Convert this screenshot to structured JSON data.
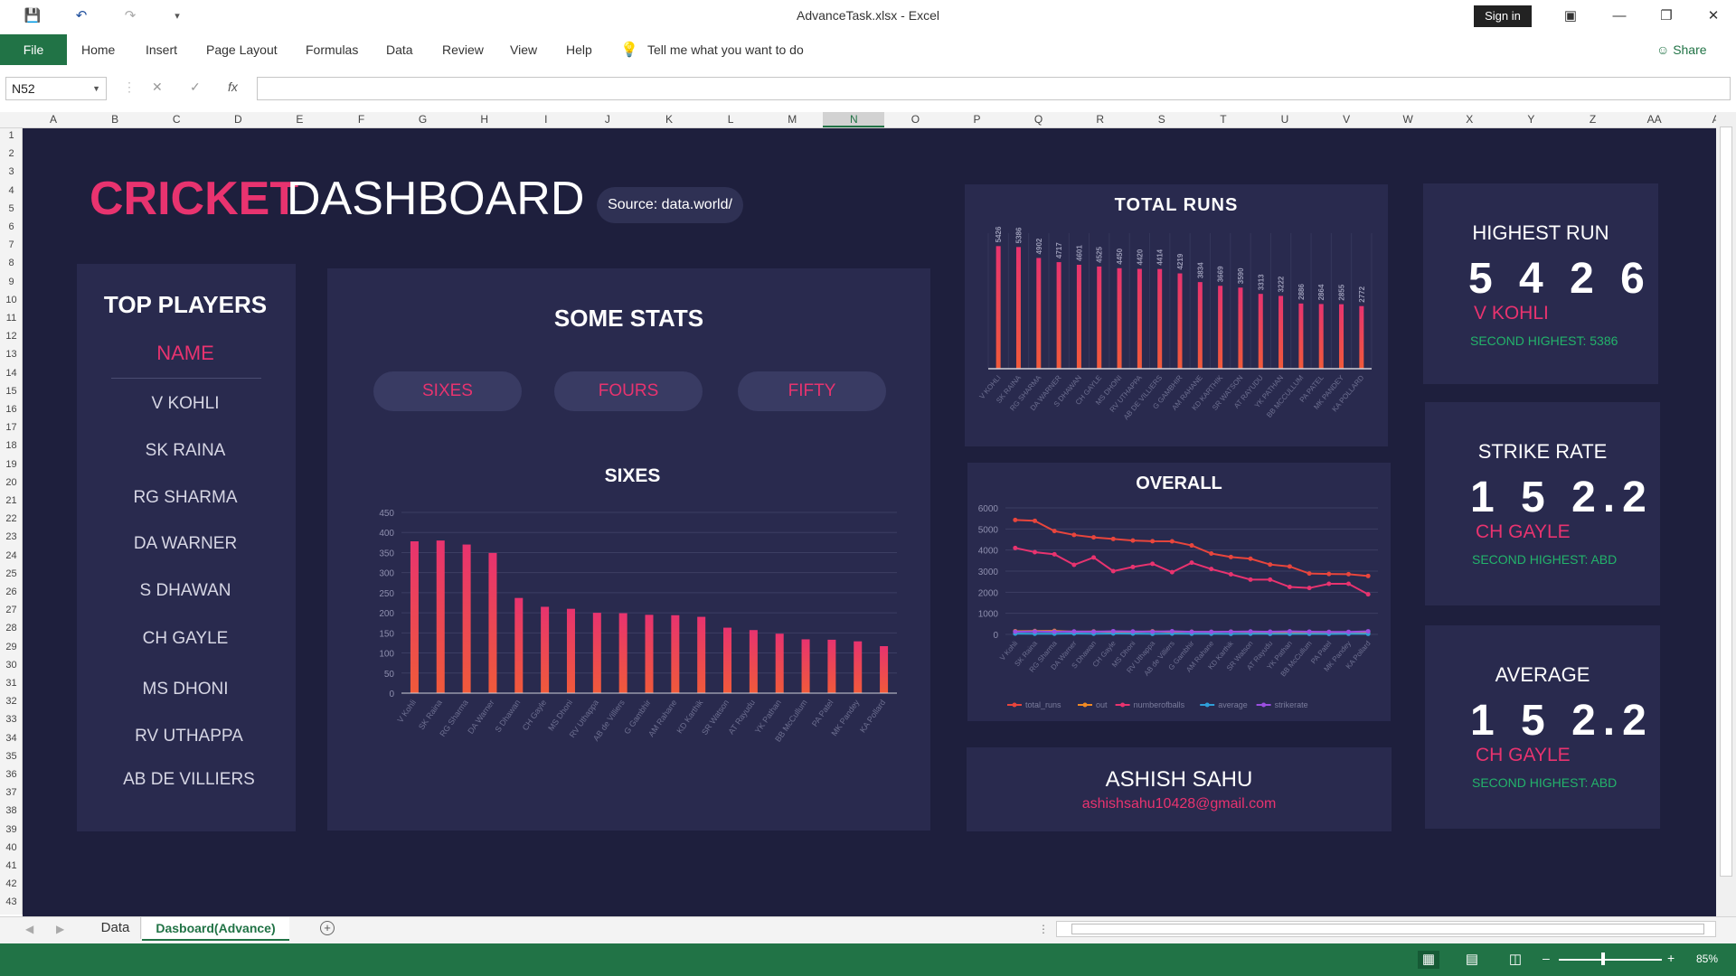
{
  "window": {
    "title": "AdvanceTask.xlsx  -  Excel",
    "sign_in": "Sign in",
    "share": "Share"
  },
  "ribbon": {
    "file": "File",
    "tabs": [
      "Home",
      "Insert",
      "Page Layout",
      "Formulas",
      "Data",
      "Review",
      "View",
      "Help"
    ],
    "tell_me": "Tell me what you want to do"
  },
  "formula_bar": {
    "name_box": "N52",
    "formula": ""
  },
  "grid": {
    "columns": [
      "A",
      "B",
      "C",
      "D",
      "E",
      "F",
      "G",
      "H",
      "I",
      "J",
      "K",
      "L",
      "M",
      "N",
      "O",
      "P",
      "Q",
      "R",
      "S",
      "T",
      "U",
      "V",
      "W",
      "X",
      "Y",
      "Z",
      "AA",
      "A"
    ],
    "selected_column": "N",
    "rows": [
      "1",
      "2",
      "3",
      "4",
      "5",
      "6",
      "7",
      "8",
      "9",
      "10",
      "11",
      "12",
      "13",
      "14",
      "15",
      "16",
      "17",
      "18",
      "19",
      "20",
      "21",
      "22",
      "23",
      "24",
      "25",
      "26",
      "27",
      "28",
      "29",
      "30",
      "31",
      "32",
      "33",
      "34",
      "35",
      "36",
      "37",
      "38",
      "39",
      "40",
      "41",
      "42",
      "43"
    ]
  },
  "dashboard": {
    "title_accent": "CRICKET",
    "title_rest": "DASHBOARD",
    "source": "Source: data.world/",
    "top_players": {
      "title": "TOP PLAYERS",
      "header": "NAME",
      "players": [
        "V KOHLI",
        "SK RAINA",
        "RG SHARMA",
        "DA WARNER",
        "S DHAWAN",
        "CH GAYLE",
        "MS DHONI",
        "RV UTHAPPA",
        "AB DE VILLIERS"
      ]
    },
    "some_stats": {
      "title": "SOME STATS",
      "buttons": [
        "SIXES",
        "FOURS",
        "FIFTY"
      ],
      "chart_title": "SIXES"
    },
    "author": {
      "name": "ASHISH SAHU",
      "email": "ashishsahu10428@gmail.com"
    },
    "kpis": [
      {
        "title": "HIGHEST RUN",
        "value": "5 4 2 6",
        "player": "V KOHLI",
        "second": "SECOND HIGHEST: 5386"
      },
      {
        "title": "STRIKE RATE",
        "value": "1 5 2.2",
        "player": "CH GAYLE",
        "second": "SECOND HIGHEST: ABD"
      },
      {
        "title": "AVERAGE",
        "value": "1 5 2.2",
        "player": "CH GAYLE",
        "second": "SECOND HIGHEST: ABD"
      }
    ],
    "colors": {
      "background": "#1e1f3d",
      "panel": "#292a4e",
      "accent": "#e8336f",
      "green": "#23b36b"
    }
  },
  "chart_data": [
    {
      "type": "bar",
      "title": "SIXES",
      "categories": [
        "V Kohli",
        "SK Raina",
        "RG Sharma",
        "DA Warner",
        "S Dhawan",
        "CH Gayle",
        "MS Dhoni",
        "RV Uthappa",
        "AB de Villiers",
        "G Gambhir",
        "AM Rahane",
        "KD Karthik",
        "SR Watson",
        "AT Rayudu",
        "YK Pathan",
        "BB McCullum",
        "PA Patel",
        "MK Pandey",
        "KA Pollard"
      ],
      "values": [
        378,
        380,
        370,
        349,
        237,
        215,
        210,
        200,
        199,
        195,
        194,
        190,
        163,
        157,
        148,
        134,
        133,
        129,
        117
      ],
      "ylim": [
        0,
        450
      ],
      "yticks": [
        0,
        50,
        100,
        150,
        200,
        250,
        300,
        350,
        400,
        450
      ],
      "grid": true
    },
    {
      "type": "bar",
      "title": "TOTAL RUNS",
      "categories": [
        "V KOHLI",
        "SK RAINA",
        "RG SHARMA",
        "DA WARNER",
        "S DHAWAN",
        "CH GAYLE",
        "MS DHONI",
        "RV UTHAPPA",
        "AB DE VILLIERS",
        "G GAMBHIR",
        "AM RAHANE",
        "KD KARTHIK",
        "SR WATSON",
        "AT RAYUDU",
        "YK PATHAN",
        "BB MCCULLUM",
        "PA PATEL",
        "MK PANDEY",
        "KA POLLARD"
      ],
      "values": [
        5426,
        5386,
        4902,
        4717,
        4601,
        4525,
        4450,
        4420,
        4414,
        4219,
        3834,
        3669,
        3590,
        3313,
        3222,
        2886,
        2864,
        2855,
        2772
      ],
      "ylim": [
        0,
        6000
      ],
      "data_labels": true
    },
    {
      "type": "line",
      "title": "OVERALL",
      "categories": [
        "V Kohli",
        "SK Raina",
        "RG Sharma",
        "DA Warner",
        "S Dhawan",
        "CH Gayle",
        "MS Dhoni",
        "RV Uthappa",
        "AB de Villiers",
        "G Gambhir",
        "AM Rahane",
        "KD Karthik",
        "SR Watson",
        "AT Rayudu",
        "YK Pathan",
        "BB McCullum",
        "PA Patel",
        "MK Pandey",
        "KA Pollard"
      ],
      "ylim": [
        0,
        6000
      ],
      "yticks": [
        0,
        1000,
        2000,
        3000,
        4000,
        5000,
        6000
      ],
      "legend": "bottom",
      "series": [
        {
          "name": "total_runs",
          "color": "#e8453c",
          "values": [
            5426,
            5386,
            4902,
            4717,
            4601,
            4525,
            4450,
            4420,
            4414,
            4219,
            3834,
            3669,
            3590,
            3313,
            3222,
            2886,
            2864,
            2855,
            2772
          ]
        },
        {
          "name": "out",
          "color": "#f08a24",
          "values": [
            150,
            160,
            165,
            130,
            140,
            120,
            110,
            145,
            120,
            125,
            115,
            130,
            110,
            105,
            100,
            105,
            110,
            95,
            90
          ]
        },
        {
          "name": "numberofballs",
          "color": "#e8336f",
          "values": [
            4100,
            3900,
            3800,
            3300,
            3650,
            3000,
            3200,
            3350,
            2950,
            3400,
            3100,
            2850,
            2600,
            2600,
            2250,
            2200,
            2400,
            2400,
            1900
          ]
        },
        {
          "name": "average",
          "color": "#2f9fd8",
          "values": [
            37,
            33,
            31,
            41,
            34,
            41,
            40,
            29,
            38,
            31,
            33,
            28,
            31,
            29,
            29,
            28,
            24,
            30,
            28
          ]
        },
        {
          "name": "strikerate",
          "color": "#9b4fe0",
          "values": [
            130,
            137,
            130,
            141,
            126,
            152,
            139,
            131,
            151,
            124,
            121,
            128,
            138,
            126,
            142,
            131,
            118,
            120,
            147
          ]
        }
      ]
    }
  ]
}
